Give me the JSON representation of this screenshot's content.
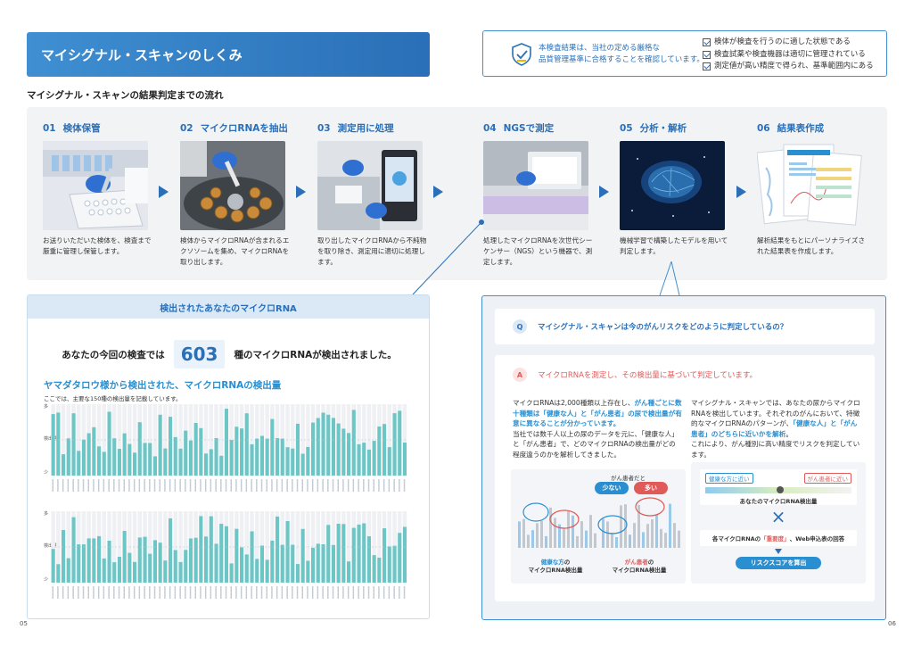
{
  "title": "マイシグナル・スキャンのしくみ",
  "quality": {
    "text_line1": "本検査結果は、当社の定める厳格な",
    "text_line2": "品質管理基準に合格することを確認しています。",
    "checks": [
      "検体が検査を行うのに適した状態である",
      "検査試薬や検査機器は適切に管理されている",
      "測定値が高い精度で得られ、基準範囲内にある"
    ]
  },
  "flow": {
    "heading": "マイシグナル・スキャンの結果判定までの流れ",
    "steps": [
      {
        "num": "01",
        "title": "検体保管",
        "desc": "お送りいただいた検体を、検査まで厳重に管理し保管します。"
      },
      {
        "num": "02",
        "title": "マイクロRNAを抽出",
        "desc": "検体からマイクロRNAが含まれるエクソソームを集め、マイクロRNAを取り出します。"
      },
      {
        "num": "03",
        "title": "測定用に処理",
        "desc": "取り出したマイクロRNAから不純物を取り除き、測定用に適切に処理します。"
      },
      {
        "num": "04",
        "title": "NGSで測定",
        "desc": "処理したマイクロRNAを次世代シーケンサー（NGS）という機器で、測定します。"
      },
      {
        "num": "05",
        "title": "分析・解析",
        "desc": "機械学習で構築したモデルを用いて判定します。"
      },
      {
        "num": "06",
        "title": "結果表作成",
        "desc": "解析結果をもとにパーソナライズされた結果表を作成します。"
      }
    ]
  },
  "detect": {
    "header": "検出されたあなたのマイクロRNA",
    "line_pre": "あなたの今回の検査では",
    "count": "603",
    "line_post": "種のマイクロRNAが検出されました。",
    "subtitle": "ヤマダタロウ様から検出された、マイクロRNAの検出量",
    "note": "ここでは、主要な150種の検出量を記載しています。",
    "axis_top": "多",
    "axis_mid": "検出量",
    "axis_bottom": "少"
  },
  "qa": {
    "q_mark": "Q",
    "question": "マイシグナル・スキャンは今のがんリスクをどのように判定しているの？",
    "a_mark": "A",
    "answer": "マイクロRNAを測定し、その検出量に基づいて判定しています。",
    "left_p1_a": "マイクロRNAは2,000種類以上存在し、",
    "left_p1_b": "がん種ごとに数十種類は「健康な人」と「がん患者」の尿で検出量が有意に異なることが分かっています。",
    "left_p2": "当社では数千人以上の尿のデータを元に、「健康な人」と「がん患者」で、どのマイクロRNAの検出量がどの程度違うのかを解析してきました。",
    "right_p1": "マイシグナル・スキャンでは、あなたの尿からマイクロRNAを検出しています。それぞれのがんにおいて、特徴的なマイクロRNAのパターンが、",
    "right_p1_b": "「健康な人」と「がん患者」のどちらに近いかを解析。",
    "right_p1_c": "これにより、がん種別に高い精度でリスクを判定しています。",
    "cancer_label": "がん患者だと",
    "pill_less": "少ない",
    "pill_more": "多い",
    "healthy_caption_a": "健康な方",
    "healthy_caption_b": "の",
    "healthy_caption_c": "マイクロRNA検出量",
    "cancer_caption_a": "がん患者",
    "cancer_caption_b": "の",
    "cancer_caption_c": "マイクロRNA検出量",
    "near_healthy": "健康な方に近い",
    "near_cancer": "がん患者に近い",
    "your_mirna": "あなたのマイクロRNA検出量",
    "times": "×",
    "importance_a": "各マイクロRNAの",
    "importance_b": "「重要度」",
    "importance_c": "、Web申込表の回答",
    "risk_button": "リスクスコアを算出"
  },
  "pages": {
    "left": "05",
    "right": "06"
  },
  "colors": {
    "blue": "#2a6fb7",
    "light_blue": "#2a8fd0",
    "pink": "#e05a5a",
    "teal": "#6cc6c6"
  }
}
